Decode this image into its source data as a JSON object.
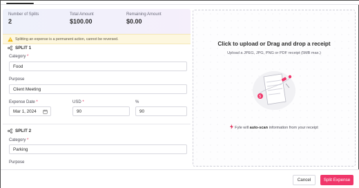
{
  "summary": {
    "splits_label": "Number of Splits",
    "splits_value": "2",
    "total_label": "Total Amount",
    "total_value": "$100.00",
    "remaining_label": "Remaining Amount",
    "remaining_value": "$0.00"
  },
  "warning": {
    "text": "Splitting an expense is a permanent action, cannot be reversed."
  },
  "split1": {
    "heading": "SPLIT 1",
    "category_label": "Category",
    "category_value": "Food",
    "purpose_label": "Purpose",
    "purpose_value": "Client Meeting",
    "date_label": "Expense Date",
    "date_value": "Mar 1, 2024",
    "currency_label": "USD",
    "amount_value": "90",
    "percent_label": "%",
    "percent_value": "90"
  },
  "split2": {
    "heading": "SPLIT 2",
    "category_label": "Category",
    "category_value": "Parking",
    "purpose_label": "Purpose"
  },
  "required_mark": "*",
  "upload": {
    "title": "Click to upload or Drag and drop a receipt",
    "subtitle": "Upload a JPEG, JPG, PNG or PDF receipt (5MB max.)",
    "scan_prefix": "Fyle will",
    "scan_bold": "auto-scan",
    "scan_suffix": "information from your receipt",
    "illustration_icon": "receipt-upload-illustration"
  },
  "footer": {
    "cancel_label": "Cancel",
    "submit_label": "Split Expense"
  },
  "colors": {
    "accent": "#f0366a",
    "warning_bg": "#fdf7df",
    "required": "#e2325c"
  }
}
